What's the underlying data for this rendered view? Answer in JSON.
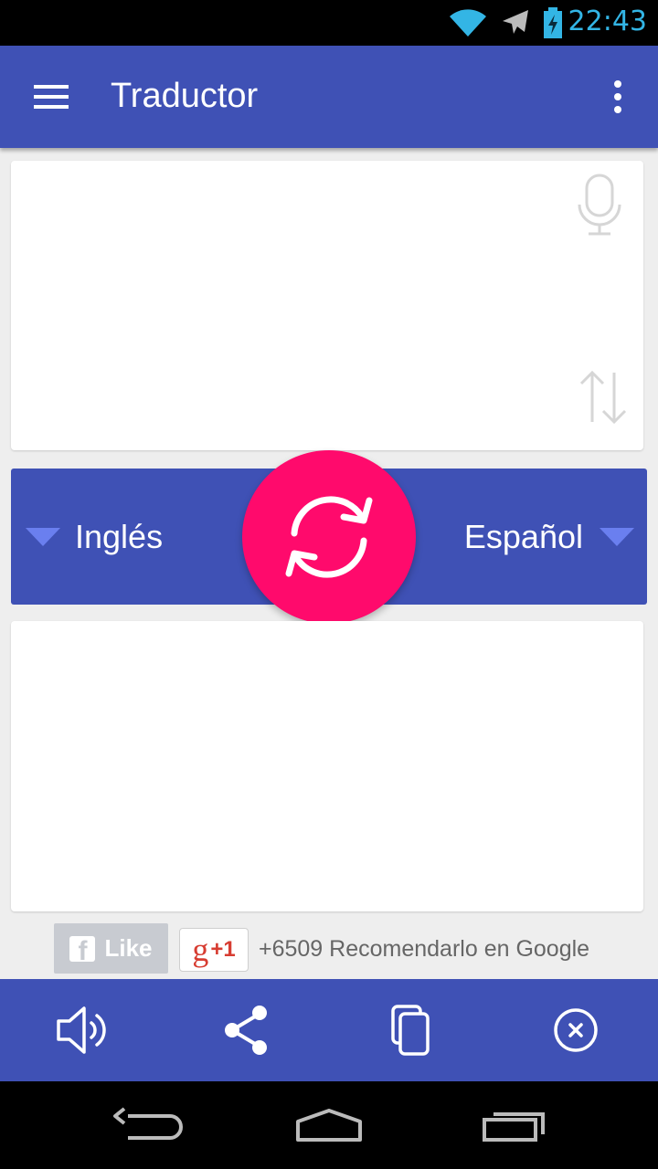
{
  "status_bar": {
    "time": "22:43",
    "icons": [
      "wifi-icon",
      "airplane-mode-icon",
      "battery-charging-icon"
    ],
    "time_color": "#33b5e5"
  },
  "app_bar": {
    "title": "Traductor",
    "color": "#3f51b5",
    "menu_icon": "hamburger-menu-icon",
    "overflow_icon": "more-vert-icon"
  },
  "source_card": {
    "text": "",
    "mic_icon": "microphone-icon",
    "swap_icon": "swap-vertical-icon"
  },
  "language_bar": {
    "source_language": "Inglés",
    "target_language": "Español",
    "translate_button_icon": "refresh-translate-icon",
    "translate_button_color": "#ff0a6c"
  },
  "target_card": {
    "text": ""
  },
  "social": {
    "facebook_like_label": "Like",
    "gplus_label": "+1",
    "recommend_text": "+6509 Recomendarlo en Google"
  },
  "bottom_bar": {
    "items": [
      "speaker-icon",
      "share-icon",
      "copy-icon",
      "clear-icon"
    ]
  },
  "nav_bar": {
    "items": [
      "back-icon",
      "home-icon",
      "recent-apps-icon"
    ]
  }
}
